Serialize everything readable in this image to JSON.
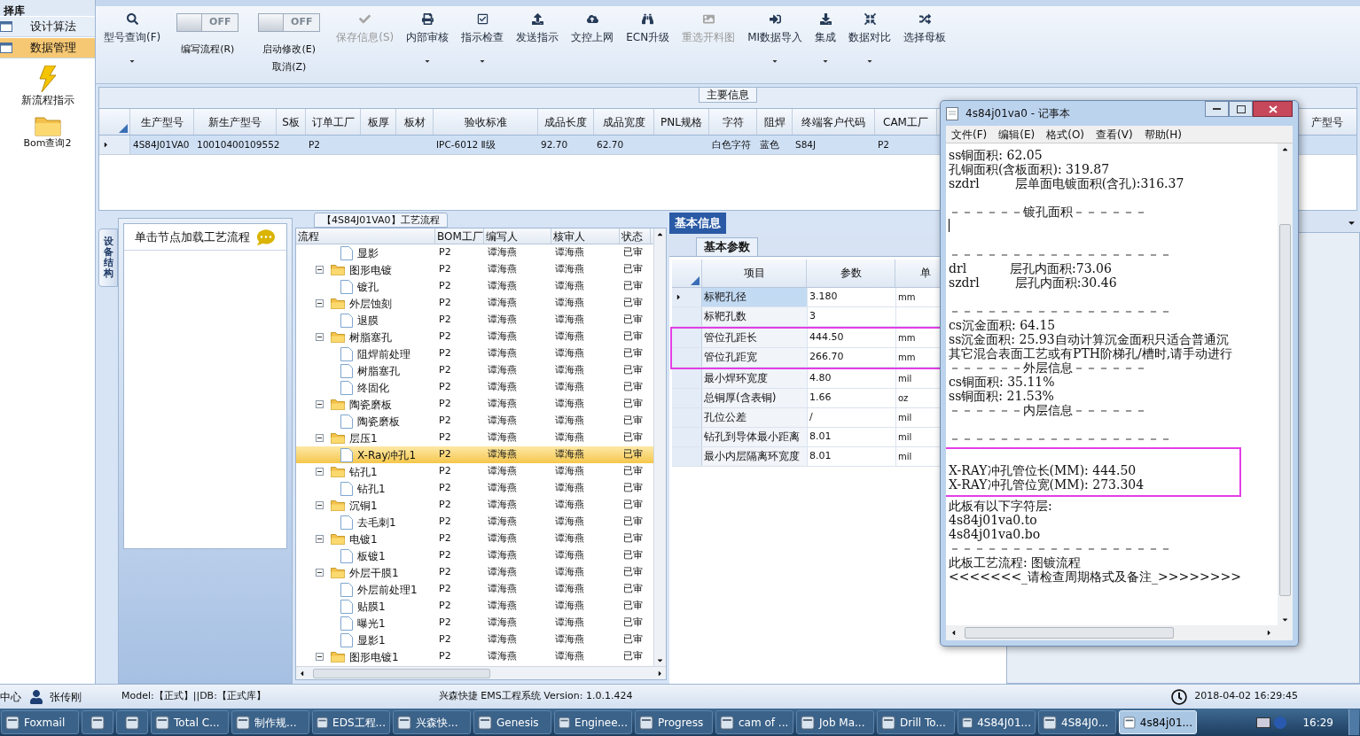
{
  "sidebar": {
    "title": "择库",
    "items": [
      {
        "label": "设计算法",
        "selected": false
      },
      {
        "label": "数据管理",
        "selected": true
      }
    ],
    "shortcuts": [
      {
        "label": "新流程指示"
      },
      {
        "label": "Bom查询2"
      }
    ]
  },
  "toolbar": [
    {
      "kind": "button",
      "label": "型号查询(F)",
      "disabled": false,
      "dropdown": true
    },
    {
      "kind": "toggle",
      "switch_text": "OFF",
      "on": false,
      "label": "编写流程(R)"
    },
    {
      "kind": "toggle",
      "switch_text": "OFF",
      "on": false,
      "label": "启动修改(E)",
      "label2": "取消(Z)"
    },
    {
      "kind": "button",
      "label": "保存信息(S)",
      "disabled": true,
      "dropdown": false
    },
    {
      "kind": "button",
      "label": "内部审核",
      "disabled": false,
      "dropdown": true
    },
    {
      "kind": "button",
      "label": "指示检查",
      "disabled": false,
      "dropdown": true
    },
    {
      "kind": "button",
      "label": "发送指示",
      "disabled": false,
      "dropdown": false
    },
    {
      "kind": "button",
      "label": "文控上网",
      "disabled": false,
      "dropdown": false
    },
    {
      "kind": "button",
      "label": "ECN升级",
      "disabled": false,
      "dropdown": false
    },
    {
      "kind": "button",
      "label": "重选开料图",
      "disabled": true,
      "dropdown": false
    },
    {
      "kind": "button",
      "label": "MI数据导入",
      "disabled": false,
      "dropdown": true
    },
    {
      "kind": "button",
      "label": "集成",
      "disabled": false,
      "dropdown": true
    },
    {
      "kind": "button",
      "label": "数据对比",
      "disabled": false,
      "dropdown": true
    },
    {
      "kind": "button",
      "label": "选择母板",
      "disabled": false,
      "dropdown": false
    }
  ],
  "main_info": {
    "title": "主要信息",
    "columns": [
      "生产型号",
      "新生产型号",
      "S板",
      "订单工厂",
      "板厚",
      "板材",
      "验收标准",
      "成品长度",
      "成品宽度",
      "PNL规格",
      "字符",
      "阻焊",
      "终端客户代码",
      "CAM工厂"
    ],
    "last_column": "产型号",
    "rows": [
      {
        "selected": true,
        "cells": [
          "4S84J01VA0",
          "10010400109552",
          "",
          "P2",
          "",
          "",
          "IPC-6012 Ⅱ级",
          "92.70",
          "62.70",
          "",
          "白色字符",
          "蓝色",
          "S84J",
          "P2"
        ]
      }
    ]
  },
  "equipment_panel": {
    "tab": "设备结构",
    "hint": "单击节点加载工艺流程"
  },
  "flow": {
    "title": "【4S84J01VA0】工艺流程",
    "columns": [
      "流程",
      "BOM工厂",
      "编写人",
      "核审人",
      "状态"
    ],
    "nodes": [
      {
        "kind": "file",
        "name": "显影",
        "bom": "P2",
        "writer": "谭海燕",
        "reviewer": "谭海燕",
        "status": "已审",
        "selected": false
      },
      {
        "kind": "folder",
        "name": "图形电镀",
        "bom": "P2",
        "writer": "谭海燕",
        "reviewer": "谭海燕",
        "status": "已审",
        "selected": false,
        "expanded": true,
        "children": [
          {
            "kind": "file",
            "name": "镀孔",
            "bom": "P2",
            "writer": "谭海燕",
            "reviewer": "谭海燕",
            "status": "已审",
            "selected": false
          }
        ]
      },
      {
        "kind": "folder",
        "name": "外层蚀刻",
        "bom": "P2",
        "writer": "谭海燕",
        "reviewer": "谭海燕",
        "status": "已审",
        "selected": false,
        "expanded": true,
        "children": [
          {
            "kind": "file",
            "name": "退膜",
            "bom": "P2",
            "writer": "谭海燕",
            "reviewer": "谭海燕",
            "status": "已审",
            "selected": false
          }
        ]
      },
      {
        "kind": "folder",
        "name": "树脂塞孔",
        "bom": "P2",
        "writer": "谭海燕",
        "reviewer": "谭海燕",
        "status": "已审",
        "selected": false,
        "expanded": true,
        "children": [
          {
            "kind": "file",
            "name": "阻焊前处理",
            "bom": "P2",
            "writer": "谭海燕",
            "reviewer": "谭海燕",
            "status": "已审",
            "selected": false
          },
          {
            "kind": "file",
            "name": "树脂塞孔",
            "bom": "P2",
            "writer": "谭海燕",
            "reviewer": "谭海燕",
            "status": "已审",
            "selected": false
          },
          {
            "kind": "file",
            "name": "终固化",
            "bom": "P2",
            "writer": "谭海燕",
            "reviewer": "谭海燕",
            "status": "已审",
            "selected": false
          }
        ]
      },
      {
        "kind": "folder",
        "name": "陶瓷磨板",
        "bom": "P2",
        "writer": "谭海燕",
        "reviewer": "谭海燕",
        "status": "已审",
        "selected": false,
        "expanded": true,
        "children": [
          {
            "kind": "file",
            "name": "陶瓷磨板",
            "bom": "P2",
            "writer": "谭海燕",
            "reviewer": "谭海燕",
            "status": "已审",
            "selected": false
          }
        ]
      },
      {
        "kind": "folder",
        "name": "层压1",
        "bom": "P2",
        "writer": "谭海燕",
        "reviewer": "谭海燕",
        "status": "已审",
        "selected": false,
        "expanded": true,
        "children": [
          {
            "kind": "file",
            "name": "X-Ray冲孔1",
            "bom": "P2",
            "writer": "谭海燕",
            "reviewer": "谭海燕",
            "status": "已审",
            "selected": true
          }
        ]
      },
      {
        "kind": "folder",
        "name": "钻孔1",
        "bom": "P2",
        "writer": "谭海燕",
        "reviewer": "谭海燕",
        "status": "已审",
        "selected": false,
        "expanded": true,
        "children": [
          {
            "kind": "file",
            "name": "钻孔1",
            "bom": "P2",
            "writer": "谭海燕",
            "reviewer": "谭海燕",
            "status": "已审",
            "selected": false
          }
        ]
      },
      {
        "kind": "folder",
        "name": "沉铜1",
        "bom": "P2",
        "writer": "谭海燕",
        "reviewer": "谭海燕",
        "status": "已审",
        "selected": false,
        "expanded": true,
        "children": [
          {
            "kind": "file",
            "name": "去毛刺1",
            "bom": "P2",
            "writer": "谭海燕",
            "reviewer": "谭海燕",
            "status": "已审",
            "selected": false
          }
        ]
      },
      {
        "kind": "folder",
        "name": "电镀1",
        "bom": "P2",
        "writer": "谭海燕",
        "reviewer": "谭海燕",
        "status": "已审",
        "selected": false,
        "expanded": true,
        "children": [
          {
            "kind": "file",
            "name": "板镀1",
            "bom": "P2",
            "writer": "谭海燕",
            "reviewer": "谭海燕",
            "status": "已审",
            "selected": false
          }
        ]
      },
      {
        "kind": "folder",
        "name": "外层干膜1",
        "bom": "P2",
        "writer": "谭海燕",
        "reviewer": "谭海燕",
        "status": "已审",
        "selected": false,
        "expanded": true,
        "children": [
          {
            "kind": "file",
            "name": "外层前处理1",
            "bom": "P2",
            "writer": "谭海燕",
            "reviewer": "谭海燕",
            "status": "已审",
            "selected": false
          },
          {
            "kind": "file",
            "name": "贴膜1",
            "bom": "P2",
            "writer": "谭海燕",
            "reviewer": "谭海燕",
            "status": "已审",
            "selected": false
          },
          {
            "kind": "file",
            "name": "曝光1",
            "bom": "P2",
            "writer": "谭海燕",
            "reviewer": "谭海燕",
            "status": "已审",
            "selected": false
          },
          {
            "kind": "file",
            "name": "显影1",
            "bom": "P2",
            "writer": "谭海燕",
            "reviewer": "谭海燕",
            "status": "已审",
            "selected": false
          }
        ]
      },
      {
        "kind": "folder",
        "name": "图形电镀1",
        "bom": "P2",
        "writer": "谭海燕",
        "reviewer": "谭海燕",
        "status": "已审",
        "selected": false,
        "expanded": true
      }
    ]
  },
  "basic_info": {
    "tab": "基本信息",
    "subtab": "基本参数",
    "columns": [
      "项目",
      "参数",
      "单"
    ],
    "rows": [
      {
        "item": "标靶孔径",
        "value": "3.180",
        "unit": "mm",
        "selected": true,
        "marked": false
      },
      {
        "item": "标靶孔数",
        "value": "3",
        "selected": false,
        "marked": false
      },
      {
        "item": "管位孔距长",
        "value": "444.50",
        "unit": "mm",
        "selected": false,
        "marked": true
      },
      {
        "item": "管位孔距宽",
        "value": "266.70",
        "unit": "mm",
        "selected": false,
        "marked": true
      },
      {
        "item": "最小焊环宽度",
        "value": "4.80",
        "unit": "mil",
        "selected": false,
        "marked": false
      },
      {
        "item": "总铜厚(含表铜)",
        "value": "1.66",
        "unit": "oz",
        "selected": false,
        "marked": false
      },
      {
        "item": "孔位公差",
        "value": "/",
        "unit": "mil",
        "selected": false,
        "marked": false
      },
      {
        "item": "钻孔到导体最小距离",
        "value": "8.01",
        "unit": "mil",
        "selected": false,
        "marked": false
      },
      {
        "item": "最小内层隔离环宽度",
        "value": "8.01",
        "unit": "mil",
        "selected": false,
        "marked": false
      }
    ]
  },
  "notepad": {
    "title": "4s84j01va0 - 记事本",
    "menu": [
      "文件(F)",
      "编辑(E)",
      "格式(O)",
      "查看(V)",
      "帮助(H)"
    ],
    "sections": [
      {
        "marked": false,
        "lines": [
          {
            "kind": "text",
            "text": "ss铜面积: 62.05"
          },
          {
            "kind": "text",
            "text": "孔铜面积(含板面积): 319.87"
          },
          {
            "kind": "text",
            "text": "szdrl         层单面电镀面积(含孔):316.37"
          },
          {
            "kind": "blank"
          },
          {
            "kind": "text",
            "text": "－－－－－－镀孔面积－－－－－－"
          },
          {
            "kind": "caret"
          },
          {
            "kind": "blank"
          },
          {
            "kind": "text",
            "text": "－－－－－－－－－－－－－－－－－－"
          },
          {
            "kind": "text",
            "text": "drl           层孔内面积:73.06"
          },
          {
            "kind": "text",
            "text": "szdrl         层孔内面积:30.46"
          },
          {
            "kind": "blank"
          },
          {
            "kind": "text",
            "text": "－－－－－－－－－－－－－－－－－－"
          },
          {
            "kind": "text",
            "text": "cs沉金面积: 64.15"
          },
          {
            "kind": "text",
            "text": "ss沉金面积: 25.93自动计算沉金面积只适合普通沉"
          },
          {
            "kind": "text",
            "text": "其它混合表面工艺或有PTH阶梯孔/槽时,请手动进行"
          },
          {
            "kind": "text",
            "text": "－－－－－－外层信息－－－－－－"
          },
          {
            "kind": "text",
            "text": "cs铜面积: 35.11%"
          },
          {
            "kind": "text",
            "text": "ss铜面积: 21.53%"
          },
          {
            "kind": "text",
            "text": "－－－－－－内层信息－－－－－－"
          },
          {
            "kind": "blank"
          },
          {
            "kind": "text",
            "text": "－－－－－－－－－－－－－－－－－－"
          }
        ]
      },
      {
        "marked": true,
        "lines": [
          {
            "kind": "blank"
          },
          {
            "kind": "text",
            "text": "X-RAY冲孔管位长(MM): 444.50"
          },
          {
            "kind": "text",
            "text": "X-RAY冲孔管位宽(MM): 273.304"
          }
        ]
      },
      {
        "marked": false,
        "lines": [
          {
            "kind": "text",
            "text": "此板有以下字符层:"
          },
          {
            "kind": "text",
            "text": "4s84j01va0.to"
          },
          {
            "kind": "text",
            "text": "4s84j01va0.bo"
          },
          {
            "kind": "text",
            "text": "－－－－－－－－－－－－－－－－－－"
          },
          {
            "kind": "text",
            "text": "此板工艺流程: 图镀流程"
          },
          {
            "kind": "text",
            "text": "<<<<<<<_请检查周期格式及备注_>>>>>>>>"
          }
        ]
      }
    ]
  },
  "status_bar": {
    "location": "中心",
    "user": "张传刚",
    "db": "Model:【正式】||DB:【正式库】",
    "app": "兴森快捷 EMS工程系统 Version: 1.0.1.424",
    "datetime": "2018-04-02 16:29:45"
  },
  "taskbar": {
    "items": [
      {
        "label": "Foxmail",
        "selected": false
      },
      {
        "selected": false
      },
      {
        "selected": false
      },
      {
        "label": "Total C...",
        "selected": false
      },
      {
        "label": "制作规...",
        "selected": false
      },
      {
        "label": "EDS工程...",
        "selected": false
      },
      {
        "label": "兴森快...",
        "selected": false
      },
      {
        "label": "Genesis",
        "selected": false
      },
      {
        "label": "Enginee...",
        "selected": false
      },
      {
        "label": "Progress",
        "selected": false
      },
      {
        "label": "cam of ...",
        "selected": false
      },
      {
        "label": "Job Ma...",
        "selected": false
      },
      {
        "label": "Drill To...",
        "selected": false
      },
      {
        "label": "4S84J01...",
        "selected": false
      },
      {
        "label": "4S84J0...",
        "selected": false
      },
      {
        "label": "4s84j01...",
        "selected": true
      }
    ],
    "clock": "16:29"
  }
}
